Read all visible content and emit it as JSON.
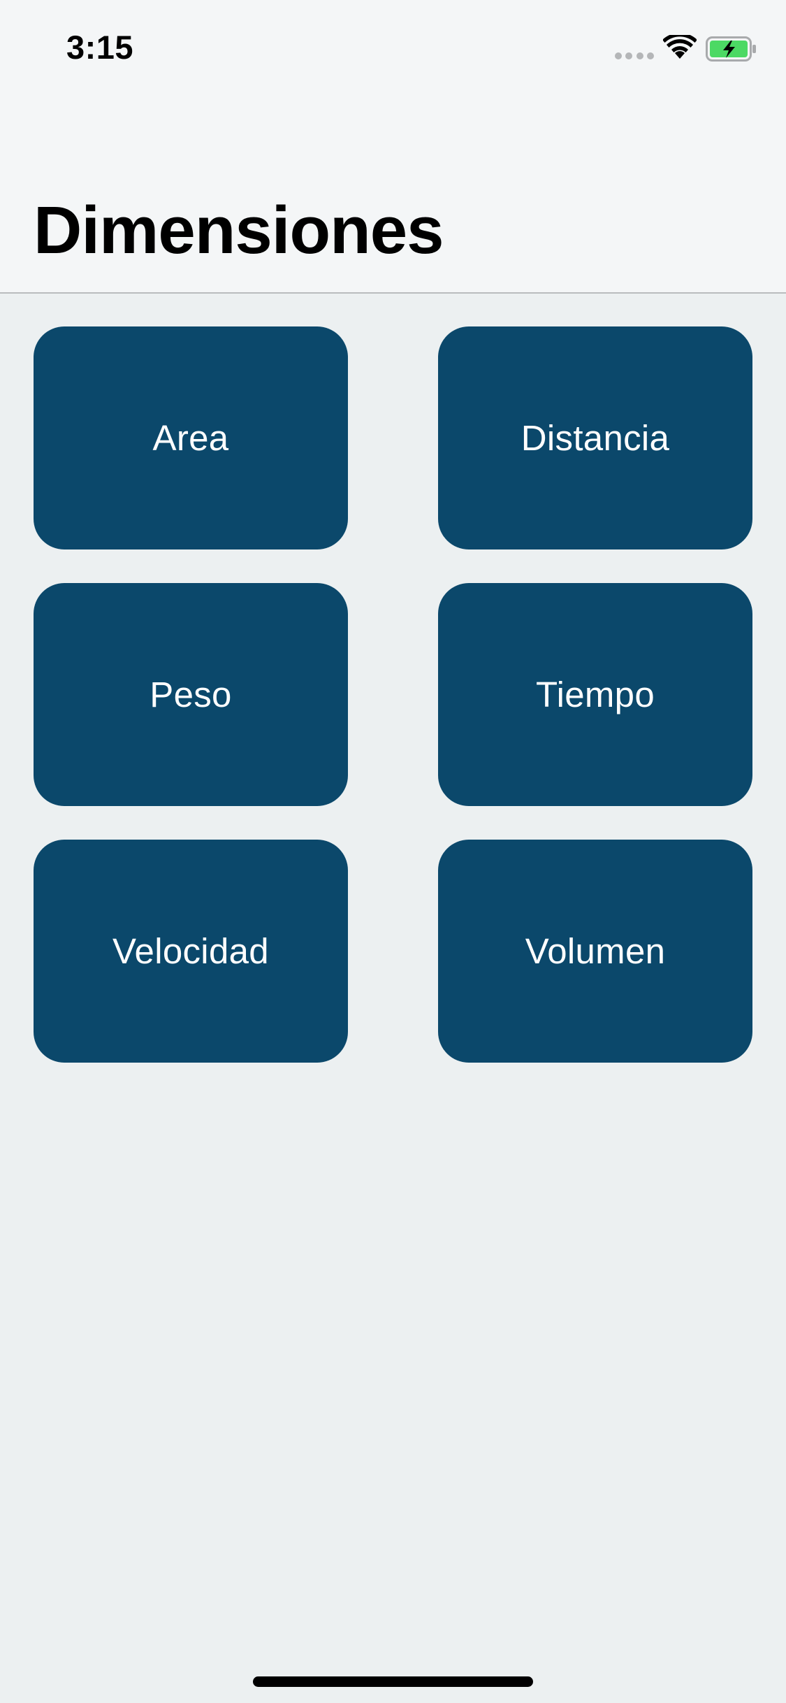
{
  "status_bar": {
    "time": "3:15",
    "icons": [
      "signal-dots-icon",
      "wifi-icon",
      "battery-charging-icon"
    ],
    "battery_color": "#4cd964"
  },
  "header": {
    "title": "Dimensiones"
  },
  "tiles": [
    {
      "label": "Area"
    },
    {
      "label": "Distancia"
    },
    {
      "label": "Peso"
    },
    {
      "label": "Tiempo"
    },
    {
      "label": "Velocidad"
    },
    {
      "label": "Volumen"
    }
  ],
  "colors": {
    "tile_background": "#0b486b",
    "tile_text": "#ffffff",
    "page_background": "#ecf0f1",
    "header_background": "#f4f6f7"
  }
}
